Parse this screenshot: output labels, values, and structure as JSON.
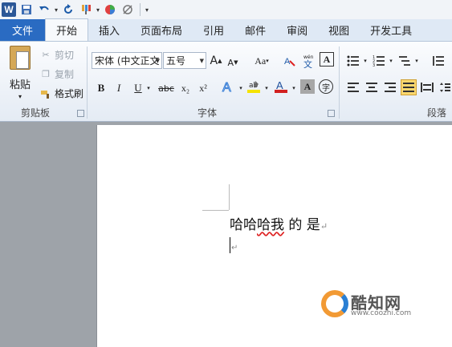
{
  "qat": {
    "app_icon": "W",
    "icons": [
      "save-icon",
      "undo-icon",
      "redo-icon",
      "format-painter-icon",
      "color-wheel-icon",
      "no-format-icon"
    ]
  },
  "tabs": {
    "file": "文件",
    "items": [
      "开始",
      "插入",
      "页面布局",
      "引用",
      "邮件",
      "审阅",
      "视图",
      "开发工具"
    ],
    "active_index": 0
  },
  "clipboard": {
    "paste": "粘贴",
    "cut": "剪切",
    "copy": "复制",
    "format_painter": "格式刷",
    "label": "剪贴板"
  },
  "font": {
    "name": "宋体 (中文正文",
    "size": "五号",
    "grow": "A",
    "shrink": "A",
    "case": "Aa",
    "bold": "B",
    "italic": "I",
    "underline": "U",
    "strike": "abc",
    "subscript": "x₂",
    "superscript": "x²",
    "label": "字体"
  },
  "paragraph": {
    "label": "段落"
  },
  "document": {
    "line1_a": "哈哈",
    "line1_b": "哈我",
    "line1_c": " 的 是",
    "para_mark": "↵"
  },
  "watermark": {
    "name": "酷知网",
    "url": "www.coozhi.com"
  },
  "colors": {
    "file_tab": "#2a6bc2",
    "selected_button": "#fbd86f",
    "highlight": "#f5e300",
    "font_color": "#d22020"
  }
}
